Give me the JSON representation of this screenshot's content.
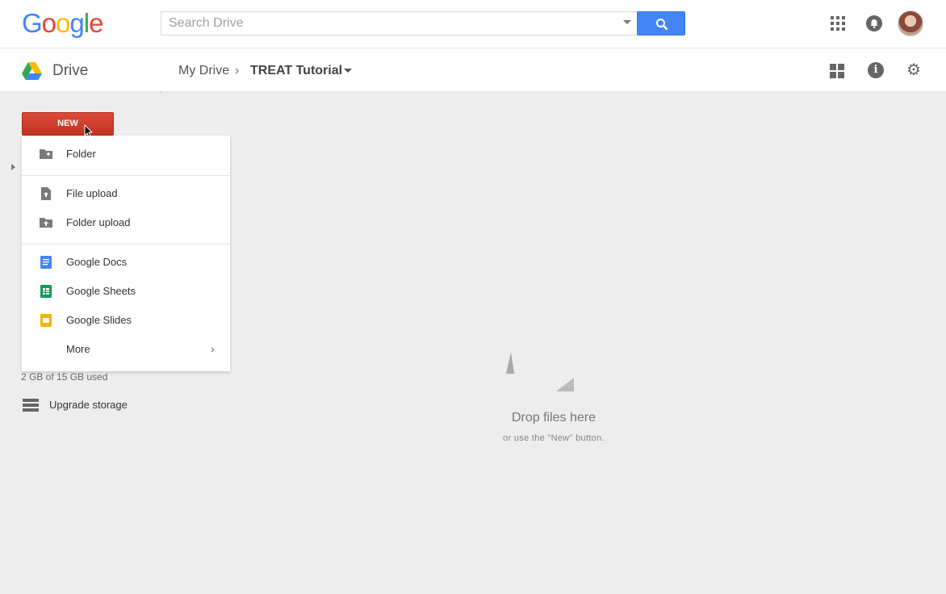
{
  "header": {
    "logo_text": [
      "G",
      "o",
      "o",
      "g",
      "l",
      "e"
    ],
    "logo_colors": [
      "#4285f4",
      "#ea4335",
      "#fbbc05",
      "#4285f4",
      "#34a853",
      "#ea4335"
    ],
    "search_placeholder": "Search Drive"
  },
  "subbar": {
    "app_title": "Drive",
    "breadcrumb_root": "My Drive",
    "breadcrumb_separator": "›",
    "breadcrumb_current": "TREAT Tutorial"
  },
  "new_button": {
    "label": "NEW",
    "color": "#dd4b39"
  },
  "menu": {
    "items": [
      {
        "label": "Folder",
        "icon": "folder-plus-icon"
      },
      {
        "label": "File upload",
        "icon": "file-upload-icon"
      },
      {
        "label": "Folder upload",
        "icon": "folder-upload-icon"
      },
      {
        "label": "Google Docs",
        "icon": "google-docs-icon",
        "color": "#4285f4"
      },
      {
        "label": "Google Sheets",
        "icon": "google-sheets-icon",
        "color": "#0f9d58"
      },
      {
        "label": "Google Slides",
        "icon": "google-slides-icon",
        "color": "#f4b400"
      },
      {
        "label": "More",
        "icon": "chevron-right-icon"
      }
    ]
  },
  "storage": {
    "usage_text": "2 GB of 15 GB used",
    "upgrade_label": "Upgrade storage"
  },
  "dropzone": {
    "title": "Drop files here",
    "subtitle": "or use the \"New\" button."
  }
}
